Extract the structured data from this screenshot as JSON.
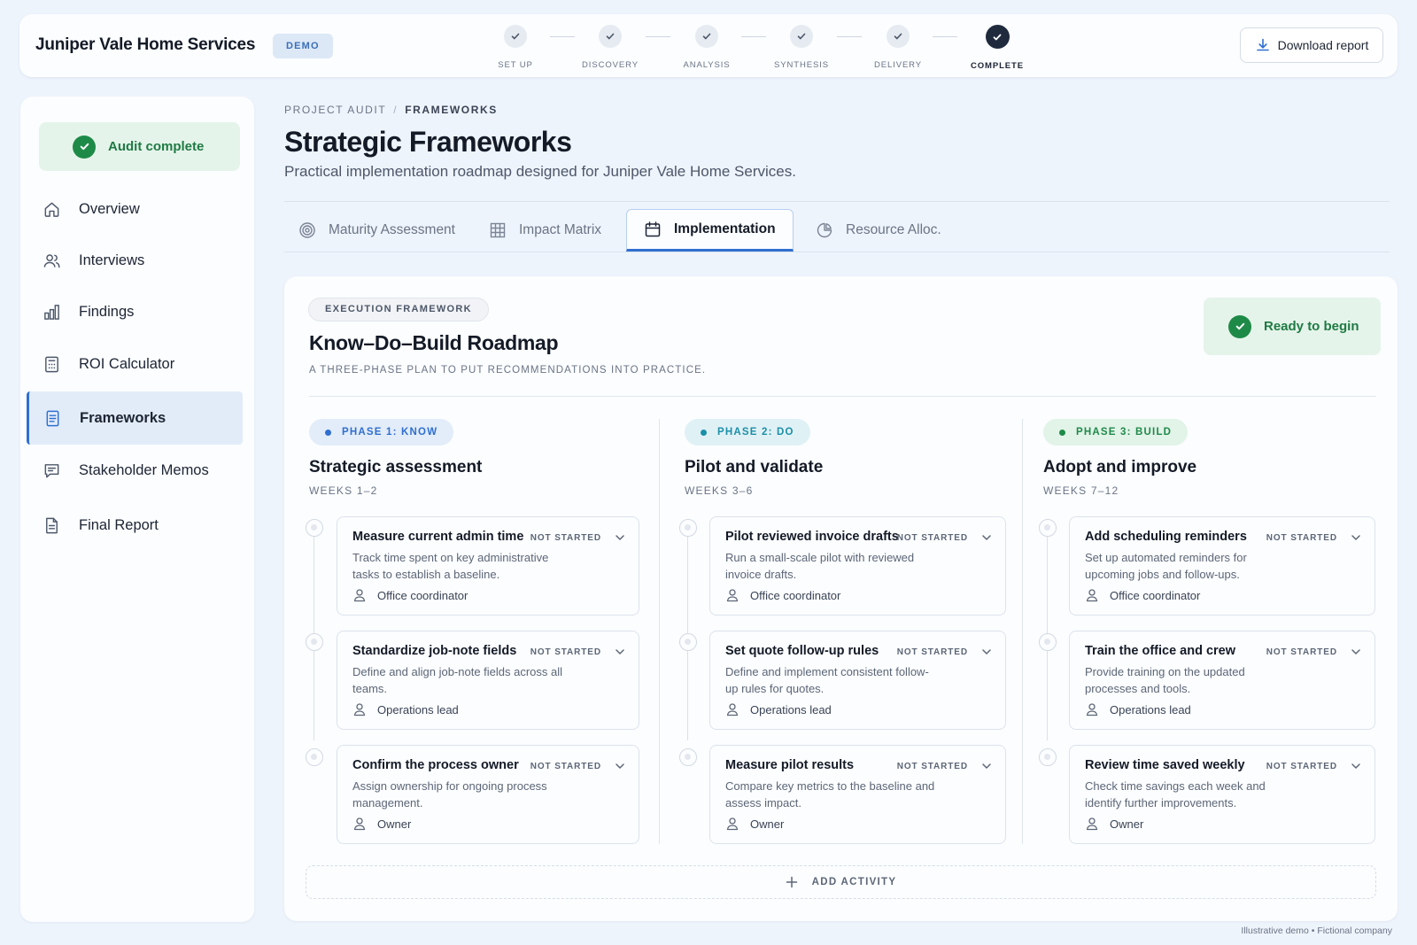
{
  "header": {
    "brand": "Juniper Vale Home Services",
    "badge": "DEMO",
    "download_label": "Download report",
    "steps": [
      {
        "label": "SET UP",
        "state": "done"
      },
      {
        "label": "DISCOVERY",
        "state": "done"
      },
      {
        "label": "ANALYSIS",
        "state": "done"
      },
      {
        "label": "SYNTHESIS",
        "state": "done"
      },
      {
        "label": "DELIVERY",
        "state": "done"
      },
      {
        "label": "COMPLETE",
        "state": "current"
      }
    ]
  },
  "sidebar": {
    "status": "Audit complete",
    "items": [
      {
        "label": "Overview",
        "icon": "home-icon"
      },
      {
        "label": "Interviews",
        "icon": "users-icon"
      },
      {
        "label": "Findings",
        "icon": "bar-chart-icon"
      },
      {
        "label": "ROI Calculator",
        "icon": "calculator-icon"
      },
      {
        "label": "Frameworks",
        "icon": "document-icon",
        "active": true
      },
      {
        "label": "Stakeholder Memos",
        "icon": "message-icon"
      },
      {
        "label": "Final Report",
        "icon": "file-icon"
      }
    ]
  },
  "main": {
    "breadcrumb": [
      "PROJECT AUDIT",
      "FRAMEWORKS"
    ],
    "breadcrumb_sep": "/",
    "title": "Strategic Frameworks",
    "subtitle": "Practical implementation roadmap designed for Juniper Vale Home Services.",
    "tabs": [
      {
        "label": "Maturity Assessment",
        "icon": "target-icon"
      },
      {
        "label": "Impact Matrix",
        "icon": "grid-icon"
      },
      {
        "label": "Implementation",
        "icon": "calendar-icon",
        "active": true
      },
      {
        "label": "Resource Alloc.",
        "icon": "pie-chart-icon"
      }
    ]
  },
  "card": {
    "tag": "EXECUTION FRAMEWORK",
    "title": "Know–Do–Build Roadmap",
    "subtitle": "A THREE-PHASE PLAN TO PUT RECOMMENDATIONS INTO PRACTICE.",
    "status": "Ready to begin",
    "add_label": "ADD ACTIVITY",
    "phases": [
      {
        "tag": "PHASE 1: KNOW",
        "title": "Strategic assessment",
        "weeks": "WEEKS 1–2",
        "color": "#2f6fd0",
        "bg": "#e3ecf9",
        "tasks": [
          {
            "title": "Measure current admin time",
            "status": "NOT STARTED",
            "desc": "Track time spent on key administrative tasks to establish a baseline.",
            "owner": "Office coordinator"
          },
          {
            "title": "Standardize job-note fields",
            "status": "NOT STARTED",
            "desc": "Define and align job-note fields across all teams.",
            "owner": "Operations lead"
          },
          {
            "title": "Confirm the process owner",
            "status": "NOT STARTED",
            "desc": "Assign ownership for ongoing process management.",
            "owner": "Owner"
          }
        ]
      },
      {
        "tag": "PHASE 2: DO",
        "title": "Pilot and validate",
        "weeks": "WEEKS 3–6",
        "color": "#1b8fa8",
        "bg": "#e0f1f6",
        "tasks": [
          {
            "title": "Pilot reviewed invoice drafts",
            "status": "NOT STARTED",
            "desc": "Run a small-scale pilot with reviewed invoice drafts.",
            "owner": "Office coordinator"
          },
          {
            "title": "Set quote follow-up rules",
            "status": "NOT STARTED",
            "desc": "Define and implement consistent follow-up rules for quotes.",
            "owner": "Operations lead"
          },
          {
            "title": "Measure pilot results",
            "status": "NOT STARTED",
            "desc": "Compare key metrics to the baseline and assess impact.",
            "owner": "Owner"
          }
        ]
      },
      {
        "tag": "PHASE 3: BUILD",
        "title": "Adopt and improve",
        "weeks": "WEEKS 7–12",
        "color": "#1e8a48",
        "bg": "#e2f3e8",
        "tasks": [
          {
            "title": "Add scheduling reminders",
            "status": "NOT STARTED",
            "desc": "Set up automated reminders for upcoming jobs and follow-ups.",
            "owner": "Office coordinator"
          },
          {
            "title": "Train the office and crew",
            "status": "NOT STARTED",
            "desc": "Provide training on the updated processes and tools.",
            "owner": "Operations lead"
          },
          {
            "title": "Review time saved weekly",
            "status": "NOT STARTED",
            "desc": "Check time savings each week and identify further improvements.",
            "owner": "Owner"
          }
        ]
      }
    ]
  },
  "footnote": "Illustrative demo • Fictional company"
}
